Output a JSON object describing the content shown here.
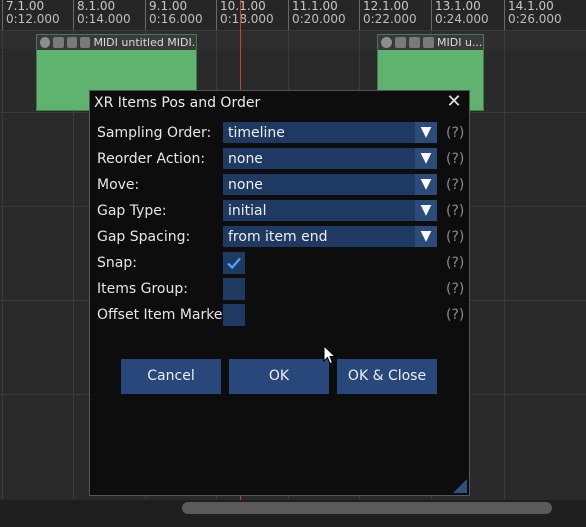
{
  "ruler": {
    "ticks": [
      {
        "bar": "7.1.00",
        "time": "0:12.000"
      },
      {
        "bar": "8.1.00",
        "time": "0:14.000"
      },
      {
        "bar": "9.1.00",
        "time": "0:16.000"
      },
      {
        "bar": "10.1.00",
        "time": "0:18.000"
      },
      {
        "bar": "11.1.00",
        "time": "0:20.000"
      },
      {
        "bar": "12.1.00",
        "time": "0:22.000"
      },
      {
        "bar": "13.1.00",
        "time": "0:24.000"
      },
      {
        "bar": "14.1.00",
        "time": "0:26.000"
      }
    ]
  },
  "items": [
    {
      "title": "MIDI untitled MIDI..."
    },
    {
      "title": "MIDI u..."
    }
  ],
  "colors": {
    "item_fill": "#5fb36e",
    "playhead": "#d23b3b",
    "accent": "#1f3a62",
    "button": "#28477a"
  },
  "dialog": {
    "title": "XR Items Pos and Order",
    "close_icon": "close-icon",
    "help_text": "(?)",
    "fields": [
      {
        "label": "Sampling Order:",
        "value": "timeline"
      },
      {
        "label": "Reorder Action:",
        "value": "none"
      },
      {
        "label": "Move:",
        "value": "none"
      },
      {
        "label": "Gap Type:",
        "value": "initial"
      },
      {
        "label": "Gap Spacing:",
        "value": "from item end"
      }
    ],
    "checks": [
      {
        "label": "Snap:",
        "checked": true
      },
      {
        "label": "Items Group:",
        "checked": false
      },
      {
        "label": "Offset Item Marker:",
        "checked": false
      }
    ],
    "buttons": {
      "cancel": "Cancel",
      "ok": "OK",
      "ok_close": "OK & Close"
    }
  }
}
